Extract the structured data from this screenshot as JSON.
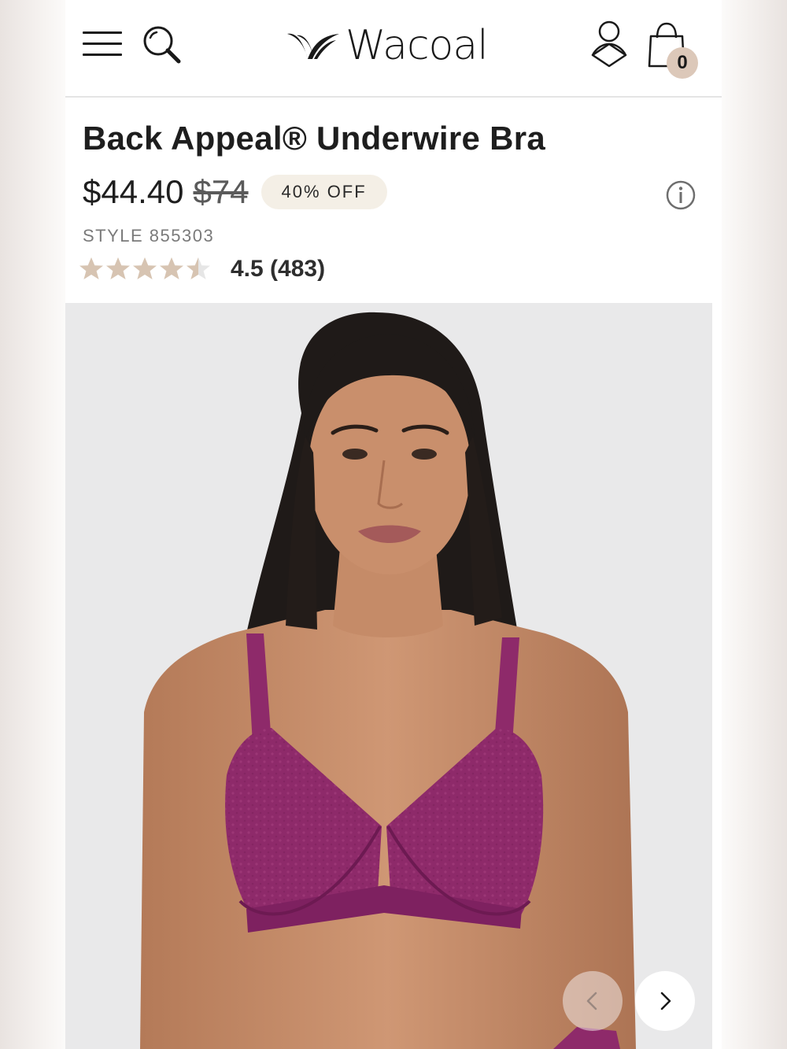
{
  "header": {
    "brand": "Wacoal",
    "cart_count": "0",
    "icons": [
      "hamburger-menu-icon",
      "search-icon",
      "account-icon",
      "shopping-bag-icon"
    ]
  },
  "product": {
    "title": "Back Appeal® Underwire Bra",
    "price": "$44.40",
    "original_price": "$74",
    "discount": "40% OFF",
    "style": "STYLE 855303",
    "rating": 4.5,
    "rating_text": "4.5 (483)"
  },
  "gallery": {
    "image_alt": "Model wearing Back Appeal Underwire Bra in plum",
    "prev_icon": "chevron-left-icon",
    "next_icon": "chevron-right-icon"
  },
  "colors": {
    "star_fill": "#d7c4b2",
    "star_empty": "#e6e6e6",
    "badge_bg": "#f4efe6",
    "cart_badge_bg": "#dcc8b9",
    "bra_color": "#8e2a6a"
  }
}
